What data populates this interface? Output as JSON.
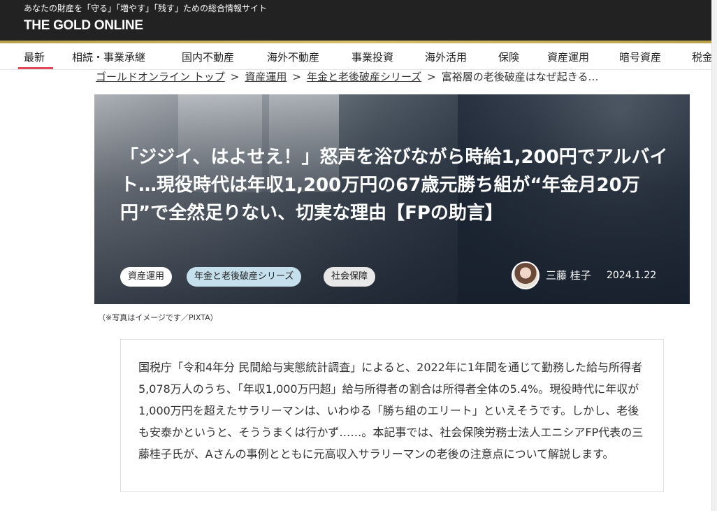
{
  "site": {
    "tagline": "あなたの財産を「守る」「増やす」「残す」ための総合情報サイト",
    "logo": "THE GOLD ONLINE",
    "accent_color": "#e5475a",
    "gold_color": "#c9b058",
    "header_bg": "#222222"
  },
  "nav": {
    "active_index": 0,
    "items": [
      "最新",
      "相続・事業承継",
      "国内不動産",
      "海外不動産",
      "事業投資",
      "海外活用",
      "保険",
      "資産運用",
      "暗号資産",
      "税金"
    ]
  },
  "breadcrumb": {
    "items": [
      "ゴールドオンライン トップ",
      "資産運用",
      "年金と老後破産シリーズ",
      "富裕層の老後破産はなぜ起きる…"
    ],
    "separator": ">"
  },
  "article": {
    "title": "「ジジイ、はよせえ！」怒声を浴びながら時給1,200円でアルバイト…現役時代は年収1,200万円の67歳元勝ち組が“年金月20万円”で全然足りない、切実な理由【FPの助言】",
    "tags": [
      "資産運用",
      "年金と老後破産シリーズ",
      "社会保障"
    ],
    "author": "三藤 桂子",
    "date": "2024.1.22",
    "photo_caption": "（※写真はイメージです／PIXTA）",
    "lead": "国税庁「令和4年分 民間給与実態統計調査」によると、2022年に1年間を通じて勤務した給与所得者5,078万人のうち、「年収1,000万円超」給与所得者の割合は所得者全体の5.4%。現役時代に年収が1,000万円を超えたサラリーマンは、いわゆる「勝ち組のエリート」といえそうです。しかし、老後も安泰かというと、そううまくは行かず……。本記事では、社会保険労務士法人エニシアFP代表の三藤桂子氏が、Aさんの事例とともに元高収入サラリーマンの老後の注意点について解説します。"
  }
}
